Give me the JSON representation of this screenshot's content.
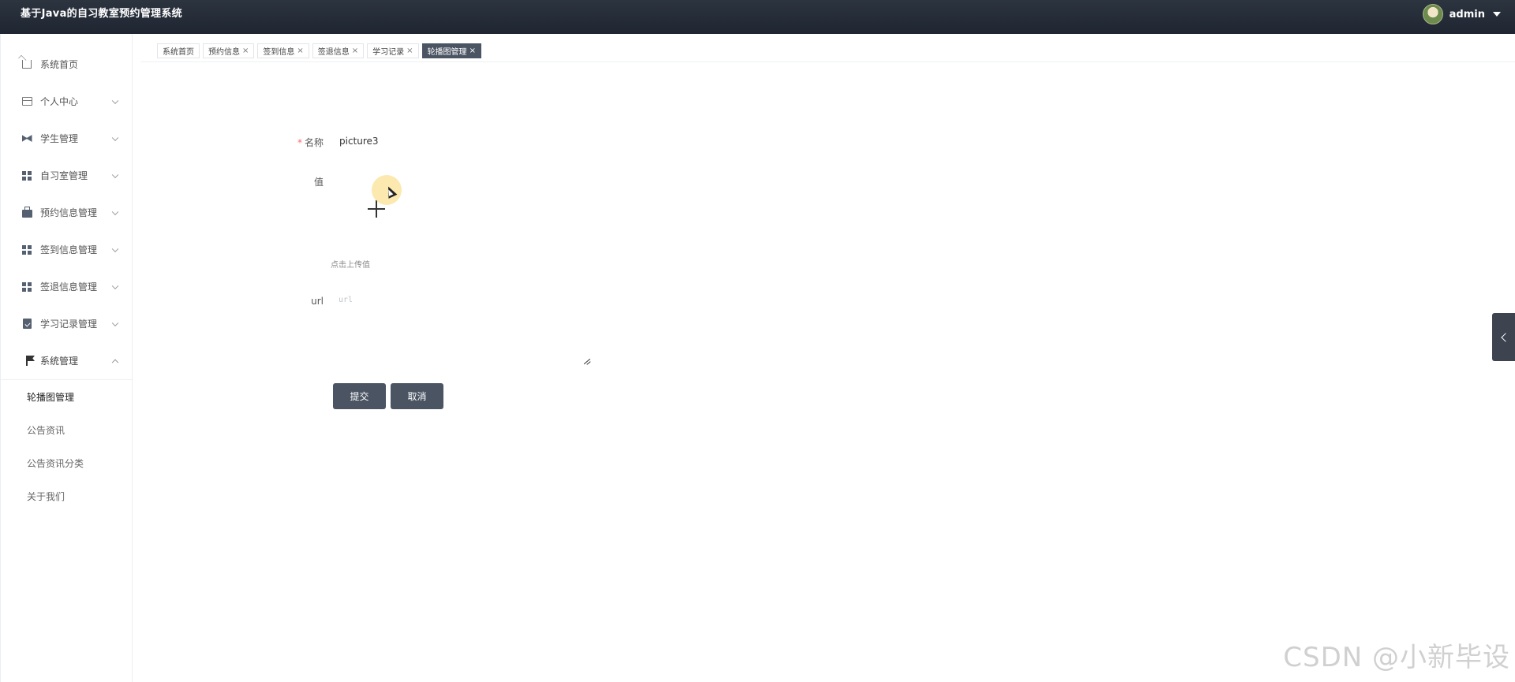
{
  "header": {
    "title": "基于Java的自习教室预约管理系统",
    "user": "admin"
  },
  "sidebar": {
    "items": [
      {
        "label": "系统首页",
        "icon": "home-icon"
      },
      {
        "label": "个人中心",
        "icon": "card-icon"
      },
      {
        "label": "学生管理",
        "icon": "bowtie-icon"
      },
      {
        "label": "自习室管理",
        "icon": "grid-icon"
      },
      {
        "label": "预约信息管理",
        "icon": "bag-icon"
      },
      {
        "label": "签到信息管理",
        "icon": "grid-icon"
      },
      {
        "label": "签退信息管理",
        "icon": "grid-icon"
      },
      {
        "label": "学习记录管理",
        "icon": "clipboard-icon"
      },
      {
        "label": "系统管理",
        "icon": "flag-icon"
      }
    ],
    "sub_items": [
      {
        "label": "轮播图管理",
        "active": true
      },
      {
        "label": "公告资讯",
        "active": false
      },
      {
        "label": "公告资讯分类",
        "active": false
      },
      {
        "label": "关于我们",
        "active": false
      }
    ]
  },
  "tabs": [
    {
      "label": "系统首页",
      "closable": false,
      "active": false
    },
    {
      "label": "预约信息",
      "closable": true,
      "active": false
    },
    {
      "label": "签到信息",
      "closable": true,
      "active": false
    },
    {
      "label": "签退信息",
      "closable": true,
      "active": false
    },
    {
      "label": "学习记录",
      "closable": true,
      "active": false
    },
    {
      "label": "轮播图管理",
      "closable": true,
      "active": true
    }
  ],
  "tab_close_glyph": "×",
  "form": {
    "name_label": "名称",
    "required_mark": "*",
    "name_value": "picture3",
    "value_label": "值",
    "upload_tip": "点击上传值",
    "url_label": "url",
    "url_placeholder": "url",
    "url_value": "",
    "submit_label": "提交",
    "cancel_label": "取消"
  },
  "watermark": "CSDN @小新毕设",
  "colors": {
    "header_bg": "#1f2631",
    "active_tab_bg": "#4a5463",
    "button_bg": "#4a5463",
    "required": "#f56c6c"
  }
}
